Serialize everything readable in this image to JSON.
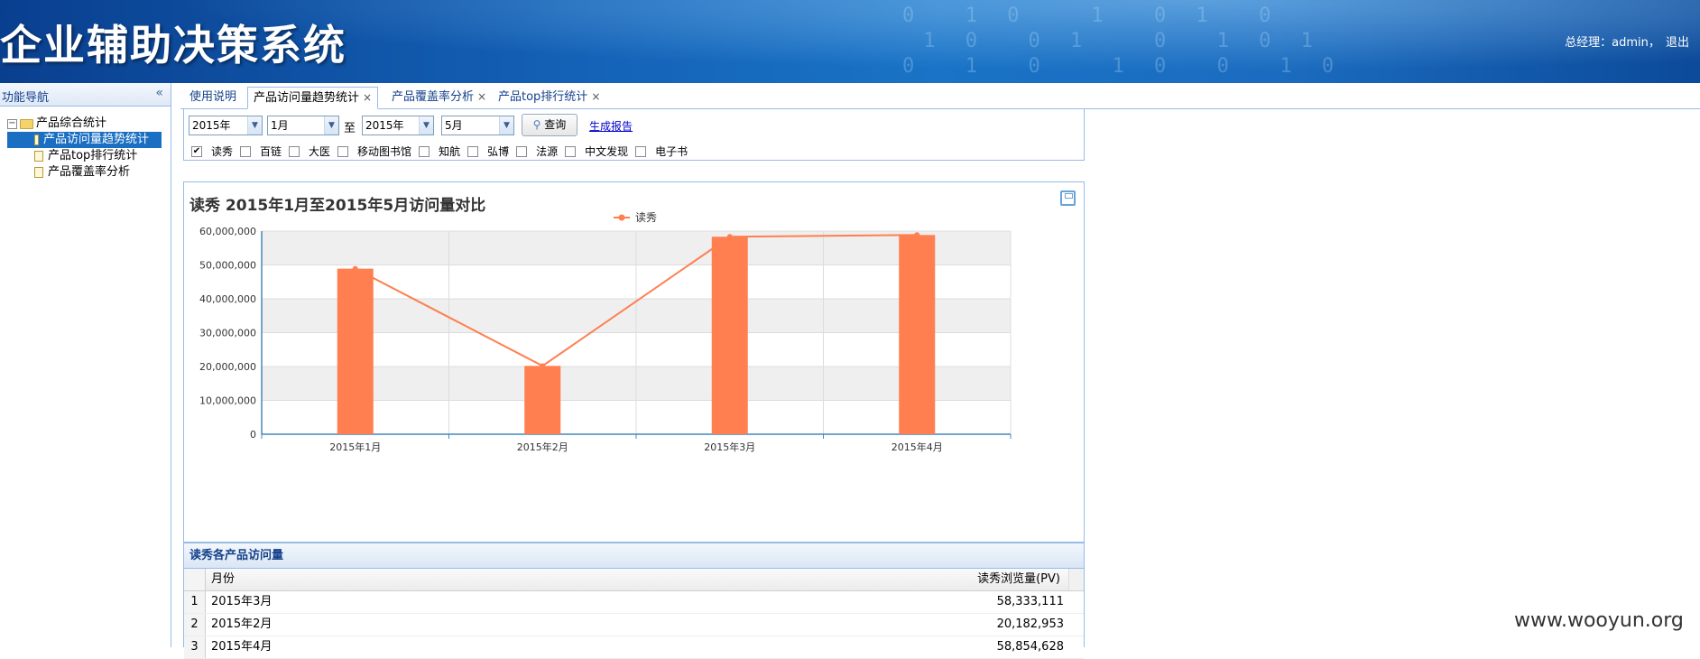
{
  "header": {
    "app_title": "企业辅助决策系统",
    "user_label": "总经理：admin，",
    "logout": "退出"
  },
  "sidebar": {
    "title": "功能导航",
    "collapse_icon": "«",
    "root": {
      "expander": "−",
      "label": "产品综合统计"
    },
    "items": [
      {
        "label": "产品访问量趋势统计",
        "selected": true
      },
      {
        "label": "产品top排行统计",
        "selected": false
      },
      {
        "label": "产品覆盖率分析",
        "selected": false
      }
    ]
  },
  "tabs": [
    {
      "label": "使用说明",
      "closable": false
    },
    {
      "label": "产品访问量趋势统计",
      "closable": true,
      "active": true
    },
    {
      "label": "产品覆盖率分析",
      "closable": true
    },
    {
      "label": "产品top排行统计",
      "closable": true
    }
  ],
  "tab_close_glyph": "×",
  "filters": {
    "from_year": "2015年",
    "from_month": "1月",
    "to_label": "至",
    "to_year": "2015年",
    "to_month": "5月",
    "query_button": "查询",
    "report_link": "生成报告",
    "products": [
      {
        "label": "读秀",
        "checked": true
      },
      {
        "label": "百链",
        "checked": false
      },
      {
        "label": "大医",
        "checked": false
      },
      {
        "label": "移动图书馆",
        "checked": false
      },
      {
        "label": "知航",
        "checked": false
      },
      {
        "label": "弘博",
        "checked": false
      },
      {
        "label": "法源",
        "checked": false
      },
      {
        "label": "中文发现",
        "checked": false
      },
      {
        "label": "电子书",
        "checked": false
      }
    ]
  },
  "chart_data": {
    "type": "bar",
    "title": "读秀 2015年1月至2015年5月访问量对比",
    "categories": [
      "2015年1月",
      "2015年2月",
      "2015年3月",
      "2015年4月"
    ],
    "series": [
      {
        "name": "读秀",
        "values": [
          48900000,
          20182953,
          58333111,
          58854628
        ]
      }
    ],
    "overlay": "line",
    "ylim": [
      0,
      60000000
    ],
    "yticks": [
      "0",
      "10,000,000",
      "20,000,000",
      "30,000,000",
      "40,000,000",
      "50,000,000",
      "60,000,000"
    ],
    "legend": "top-center",
    "grid": true,
    "color": "#ff7f50"
  },
  "grid": {
    "title": "读秀各产品访问量",
    "columns": {
      "month": "月份",
      "pv": "读秀浏览量(PV)"
    },
    "rows": [
      {
        "num": "1",
        "month": "2015年3月",
        "pv": "58,333,111"
      },
      {
        "num": "2",
        "month": "2015年2月",
        "pv": "20,182,953"
      },
      {
        "num": "3",
        "month": "2015年4月",
        "pv": "58,854,628"
      }
    ]
  },
  "watermark": "www.wooyun.org"
}
